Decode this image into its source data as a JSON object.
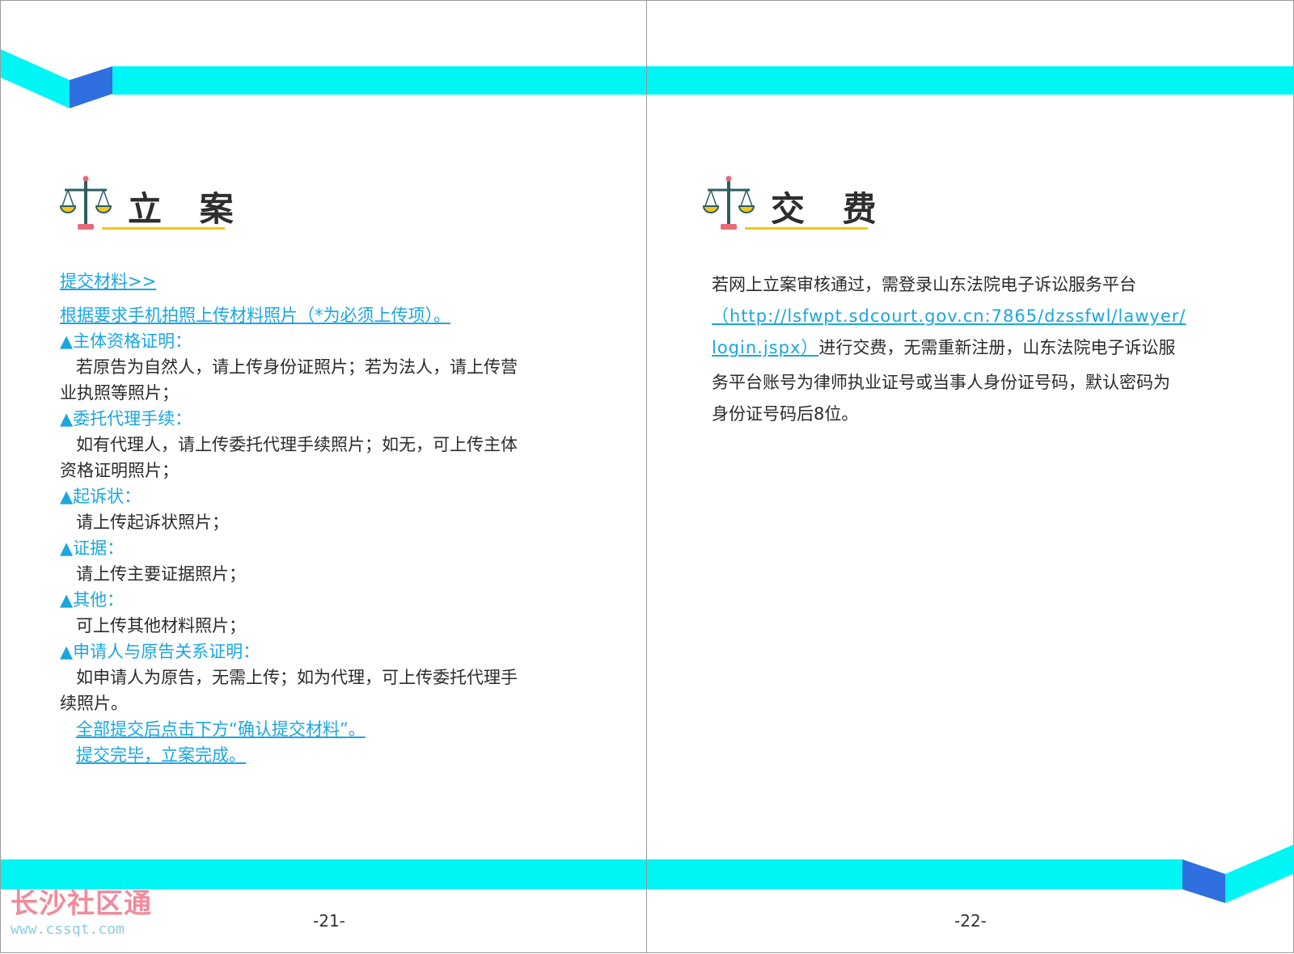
{
  "colors": {
    "cyan_band": "#00f5f5",
    "blue_accent": "#2f6fe0",
    "link_blue": "#1aa6df",
    "title_underline": "#f4c51a",
    "watermark_red": "#f18b9c",
    "watermark_blue": "#8fcbe0"
  },
  "left": {
    "title": "立 案",
    "lines": [
      {
        "text": "提交材料>>",
        "style": "link"
      },
      {
        "text": "根据要求手机拍照上传材料照片（*为必须上传项）。",
        "style": "link"
      },
      {
        "text": "▲主体资格证明：",
        "style": "heading"
      },
      {
        "text": "若原告为自然人，请上传身份证照片；若为法人，请上传营",
        "style": "body",
        "indent": true
      },
      {
        "text": "业执照等照片；",
        "style": "body"
      },
      {
        "text": "▲委托代理手续：",
        "style": "heading"
      },
      {
        "text": "如有代理人，请上传委托代理手续照片；如无，可上传主体",
        "style": "body",
        "indent": true
      },
      {
        "text": "资格证明照片；",
        "style": "body"
      },
      {
        "text": "▲起诉状：",
        "style": "heading"
      },
      {
        "text": "请上传起诉状照片；",
        "style": "body",
        "indent": true
      },
      {
        "text": "▲证据：",
        "style": "heading"
      },
      {
        "text": "请上传主要证据照片；",
        "style": "body",
        "indent": true
      },
      {
        "text": "▲其他：",
        "style": "heading"
      },
      {
        "text": "可上传其他材料照片；",
        "style": "body",
        "indent": true
      },
      {
        "text": "▲申请人与原告关系证明：",
        "style": "heading"
      },
      {
        "text": "如申请人为原告，无需上传；如为代理，可上传委托代理手",
        "style": "body",
        "indent": true
      },
      {
        "text": "续照片。",
        "style": "body"
      },
      {
        "text": "全部提交后点击下方“确认提交材料”。",
        "style": "link",
        "indent": true
      },
      {
        "text": "提交完毕，立案完成。",
        "style": "link",
        "indent": true
      }
    ],
    "page_number": "-21-"
  },
  "right": {
    "title": "交 费",
    "p1": "若网上立案审核通过，需登录山东法院电子诉讼服务平台",
    "url1": "（http://lsfwpt.sdcourt.gov.cn:7865/dzssfwl/lawyer/",
    "url2": "login.jspx）",
    "p2": "进行交费，无需重新注册，山东法院电子诉讼服",
    "p3": "务平台账号为律师执业证号或当事人身份证号码，默认密码为",
    "p4": "身份证号码后8位。",
    "page_number": "-22-"
  },
  "watermark": {
    "text": "长沙社区通",
    "url": "www.cssqt.com"
  }
}
